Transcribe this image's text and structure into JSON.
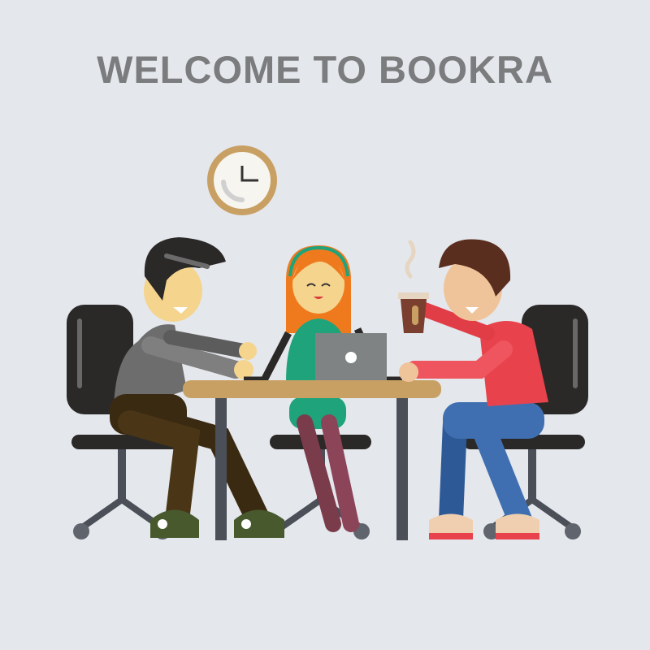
{
  "header": {
    "title": "WELCOME TO BOOKRA"
  },
  "colors": {
    "background": "#e4e7ec",
    "title": "#7b7c7e",
    "clock_rim": "#c9a063",
    "table_top": "#c9a063",
    "chair": "#2b2927",
    "left_person_shirt": "#6d6d6d",
    "middle_person_shirt": "#1fa37a",
    "middle_person_hair": "#ef7a1e",
    "right_person_shirt": "#e8434d",
    "right_person_jeans": "#3f6fb0"
  },
  "illustration": {
    "icons": [
      "clock-icon",
      "chair-icon",
      "laptop-icon",
      "coffee-cup-icon",
      "table-icon"
    ]
  }
}
